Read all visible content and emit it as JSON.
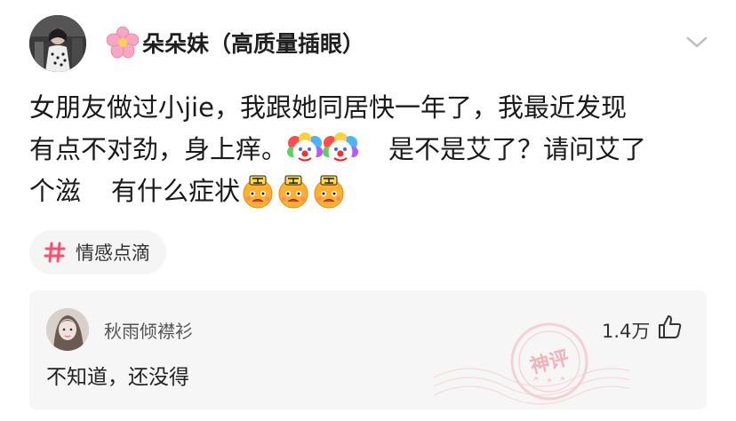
{
  "author": {
    "emoji": "🌸",
    "name": "朵朵妹（高质量插眼）"
  },
  "post": {
    "line1": "女朋友做过小jie，我跟她同居快一年了，我最近发现",
    "line2_a": "有点不对劲，身上痒。",
    "line2_b": "是不是艾了？请问艾了",
    "line3_a": "个滋",
    "line3_b": "有什么症状"
  },
  "tag": {
    "label": "情感点滴"
  },
  "comment": {
    "author": "秋雨倾襟衫",
    "likes": "1.4万",
    "text": "不知道，还没得",
    "badge": "神评"
  },
  "icons": [
    "avatar",
    "flower-emoji",
    "chevron-down-icon",
    "clown-emoji",
    "annoyed-emoji",
    "hashtag-icon",
    "thumbs-up-icon",
    "god-comment-stamp"
  ],
  "colors": {
    "tag_hash": "#ff4f6a",
    "stamp": "#f3c4c8",
    "card_bg": "#f6f6f6"
  }
}
